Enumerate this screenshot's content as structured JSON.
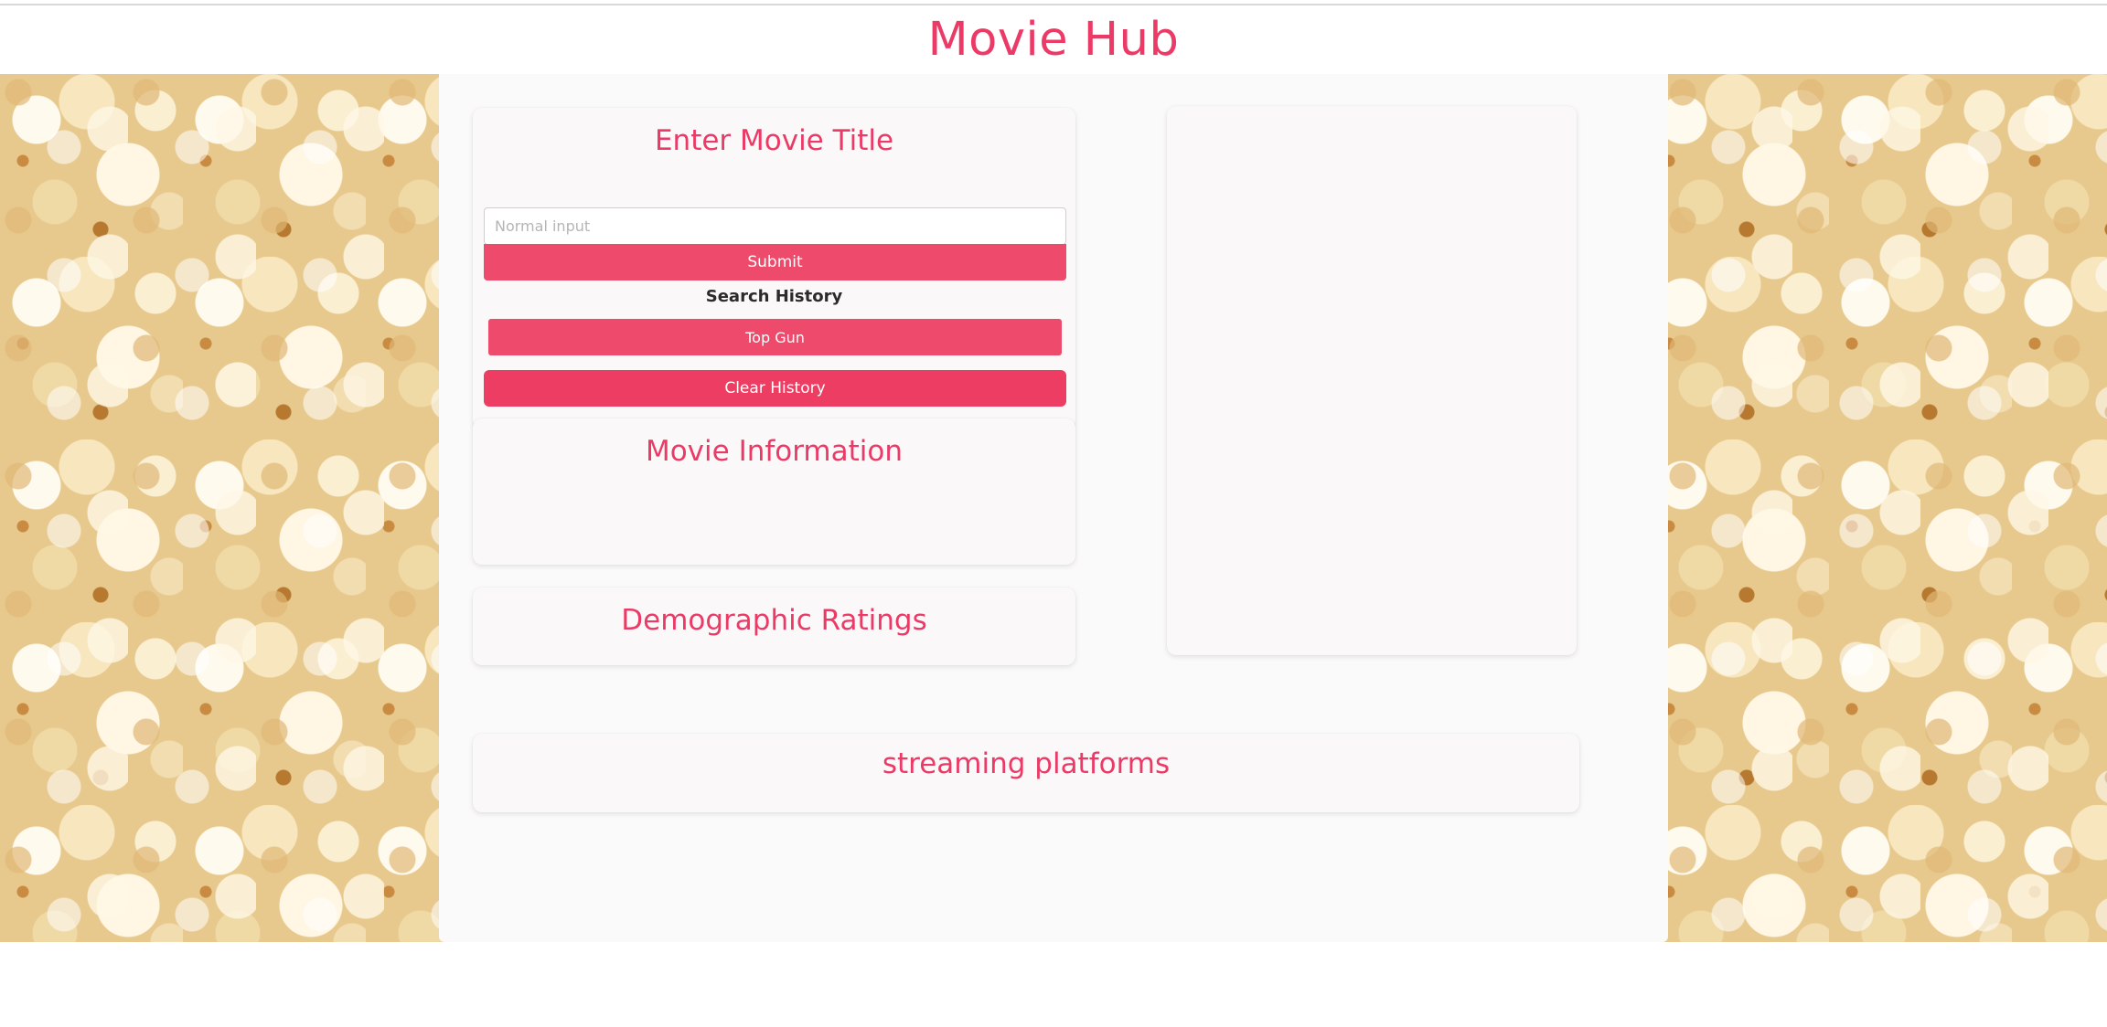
{
  "header": {
    "title": "Movie Hub"
  },
  "search": {
    "title": "Enter Movie Title",
    "placeholder": "Normal input",
    "value": "",
    "submit_label": "Submit",
    "history_label": "Search History",
    "history_items": [
      "Top Gun"
    ],
    "clear_label": "Clear History"
  },
  "movie_info": {
    "title": "Movie Information"
  },
  "ratings": {
    "title": "Demographic Ratings"
  },
  "streaming": {
    "title": "streaming platforms"
  },
  "colors": {
    "accent": "#ec3a67",
    "button": "#ee4a6b",
    "panel": "#fafafa"
  }
}
